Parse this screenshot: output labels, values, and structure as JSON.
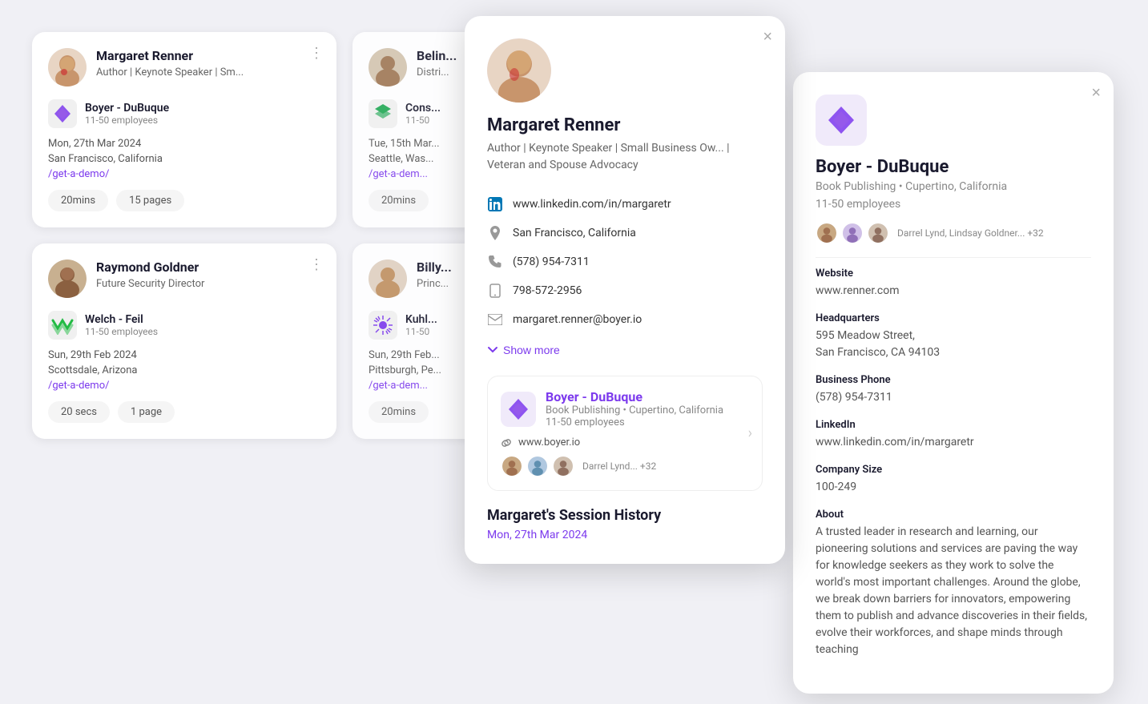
{
  "cards": [
    {
      "id": "card-1",
      "name": "Margaret Renner",
      "title": "Author | Keynote Speaker | Sm...",
      "company": {
        "name": "Boyer - DuBuque",
        "size": "11-50 employees",
        "logo": "purple-diamond"
      },
      "date": "Mon, 27th Mar 2024",
      "location": "San Francisco, California",
      "link": "/get-a-demo/",
      "duration": "20mins",
      "pages": "15 pages"
    },
    {
      "id": "card-2",
      "name": "Belin...",
      "title": "Distri...",
      "company": {
        "name": "Cons...",
        "size": "11-50",
        "logo": "green-arrows"
      },
      "date": "Tue, 15th Mar...",
      "location": "Seattle, Was...",
      "link": "/get-a-dem...",
      "duration": "20mins",
      "pages": null
    },
    {
      "id": "card-3",
      "name": "Raymond Goldner",
      "title": "Future Security Director",
      "company": {
        "name": "Welch - Feil",
        "size": "11-50 employees",
        "logo": "green-zigzag"
      },
      "date": "Sun, 29th Feb 2024",
      "location": "Scottsdale, Arizona",
      "link": "/get-a-demo/",
      "duration": "20 secs",
      "pages": "1 page"
    },
    {
      "id": "card-4",
      "name": "Billy...",
      "title": "Princ...",
      "company": {
        "name": "Kuhl...",
        "size": "11-50",
        "logo": "purple-burst"
      },
      "date": "Sun, 29th Feb...",
      "location": "Pittsburgh, Pe...",
      "link": "/get-a-dem...",
      "duration": "20mins",
      "pages": null
    }
  ],
  "popup_person": {
    "name": "Margaret Renner",
    "subtitle": "Author | Keynote Speaker | Small Business Ow... | Veteran and Spouse Advocacy",
    "linkedin": "www.linkedin.com/in/margaretr",
    "location": "San Francisco, California",
    "phone": "(578) 954-7311",
    "mobile": "798-572-2956",
    "email": "margaret.renner@boyer.io",
    "show_more": "Show more",
    "company": {
      "name": "Boyer - DuBuque",
      "meta": "Book Publishing • Cupertino, California",
      "size": "11-50 employees",
      "website": "www.boyer.io",
      "employees": "Darrel Lynd... +32"
    },
    "session_history_title": "Margaret's Session History",
    "session_date": "Mon, 27th Mar 2024"
  },
  "popup_company": {
    "name": "Boyer - DuBuque",
    "meta": "Book Publishing • Cupertino, California",
    "size": "11-50 employees",
    "employees_text": "Darrel Lynd, Lindsay Goldner... +32",
    "website_label": "Website",
    "website_value": "www.renner.com",
    "headquarters_label": "Headquarters",
    "headquarters_value": "595 Meadow Street,\nSan Francisco, CA 94103",
    "business_phone_label": "Business Phone",
    "business_phone_value": "(578) 954-7311",
    "linkedin_label": "LinkedIn",
    "linkedin_value": "www.linkedin.com/in/margaretr",
    "company_size_label": "Company Size",
    "company_size_value": "100-249",
    "about_label": "About",
    "about_value": "A trusted leader in research and learning, our pioneering solutions and services are paving the way for knowledge seekers as they work to solve the world's most important challenges. Around the globe, we break down barriers for innovators, empowering them to publish and advance discoveries in their fields, evolve their workforces, and shape minds through teaching"
  },
  "icons": {
    "close": "×",
    "dots": "⋮",
    "chevron_down": "⌄",
    "link_icon": "🔗",
    "location_pin": "◎",
    "phone": "📞",
    "mobile": "📱",
    "email": "✉"
  }
}
